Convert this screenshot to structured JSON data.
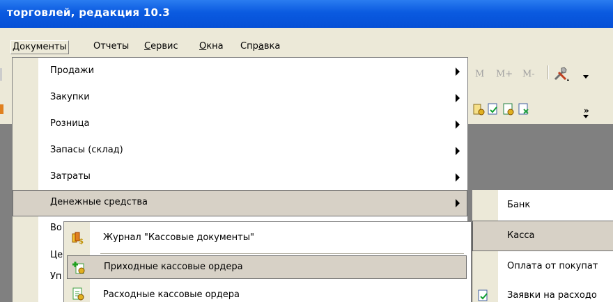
{
  "window": {
    "title": "торговлей, редакция 10.3"
  },
  "menubar": {
    "items": [
      {
        "label_pre": "",
        "label_u": "Д",
        "label_post": "окументы"
      },
      {
        "label_pre": "",
        "label_u": "",
        "label_post": "Отчеты"
      },
      {
        "label_pre": "",
        "label_u": "С",
        "label_post": "ервис"
      },
      {
        "label_pre": "",
        "label_u": "О",
        "label_post": "кна"
      },
      {
        "label_pre": "Спр",
        "label_u": "а",
        "label_post": "вка"
      }
    ]
  },
  "toolbar": {
    "memory_buttons": [
      "M",
      "M+",
      "M-"
    ]
  },
  "documents_menu": {
    "items": [
      {
        "label": "Продажи",
        "has_submenu": true
      },
      {
        "label": "Закупки",
        "has_submenu": true
      },
      {
        "label": "Розница",
        "has_submenu": true
      },
      {
        "label": "Запасы (склад)",
        "has_submenu": true
      },
      {
        "label": "Затраты",
        "has_submenu": true
      },
      {
        "label": "Денежные средства",
        "has_submenu": true,
        "highlighted": true
      },
      {
        "label": "Во"
      },
      {
        "label": "Це"
      },
      {
        "label": "Уп"
      }
    ]
  },
  "money_submenu": {
    "items": [
      {
        "label": "Банк"
      },
      {
        "label": "Касса",
        "highlighted": true
      },
      {
        "label": "Оплата от покупат"
      },
      {
        "label": "Заявки на расходо"
      }
    ]
  },
  "cash_submenu": {
    "items": [
      {
        "label": "Журнал \"Кассовые документы\"",
        "icon": "cash-journal-icon"
      },
      {
        "label": "Приходные кассовые ордера",
        "icon": "incoming-cash-order-icon",
        "highlighted": true
      },
      {
        "label": "Расходные кассовые ордера",
        "icon": "outgoing-cash-order-icon"
      }
    ]
  }
}
